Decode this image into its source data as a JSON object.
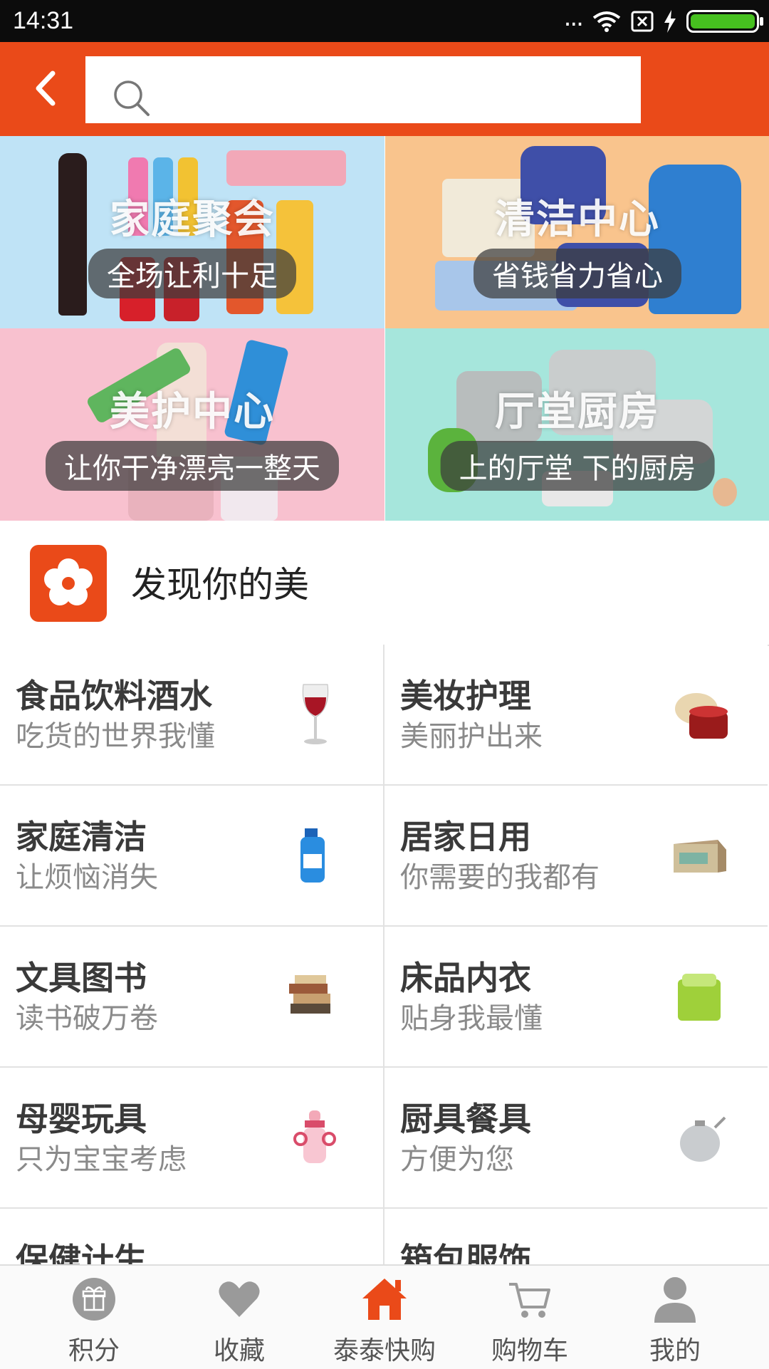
{
  "status_bar": {
    "time": "14:31",
    "signal_dots": "..."
  },
  "search": {
    "placeholder": ""
  },
  "banners": [
    {
      "title": "家庭聚会",
      "subtitle": "全场让利十足"
    },
    {
      "title": "清洁中心",
      "subtitle": "省钱省力省心"
    },
    {
      "title": "美护中心",
      "subtitle": "让你干净漂亮一整天"
    },
    {
      "title": "厅堂厨房",
      "subtitle": "上的厅堂 下的厨房"
    }
  ],
  "section": {
    "title": "发现你的美"
  },
  "categories": [
    {
      "name": "食品饮料酒水",
      "sub": "吃货的世界我懂",
      "icon": "wine-glass-icon"
    },
    {
      "name": "美妆护理",
      "sub": "美丽护出来",
      "icon": "cream-jar-icon"
    },
    {
      "name": "家庭清洁",
      "sub": "让烦恼消失",
      "icon": "detergent-bottle-icon"
    },
    {
      "name": "居家日用",
      "sub": "你需要的我都有",
      "icon": "storage-box-icon"
    },
    {
      "name": "文具图书",
      "sub": "读书破万卷",
      "icon": "books-icon"
    },
    {
      "name": "床品内衣",
      "sub": "贴身我最懂",
      "icon": "bedding-icon"
    },
    {
      "name": "母婴玩具",
      "sub": "只为宝宝考虑",
      "icon": "baby-bottle-icon"
    },
    {
      "name": "厨具餐具",
      "sub": "方便为您",
      "icon": "teapot-icon"
    },
    {
      "name": "保健计生",
      "sub": "",
      "icon": "health-icon"
    },
    {
      "name": "箱包服饰",
      "sub": "",
      "icon": "bag-icon"
    }
  ],
  "tabbar": [
    {
      "label": "积分",
      "icon": "gift-icon"
    },
    {
      "label": "收藏",
      "icon": "heart-icon"
    },
    {
      "label": "泰泰快购",
      "icon": "home-icon"
    },
    {
      "label": "购物车",
      "icon": "cart-icon"
    },
    {
      "label": "我的",
      "icon": "user-icon"
    }
  ],
  "colors": {
    "brand": "#ea4a19",
    "text": "#3a3a3a",
    "subtext": "#8a8a8a"
  }
}
